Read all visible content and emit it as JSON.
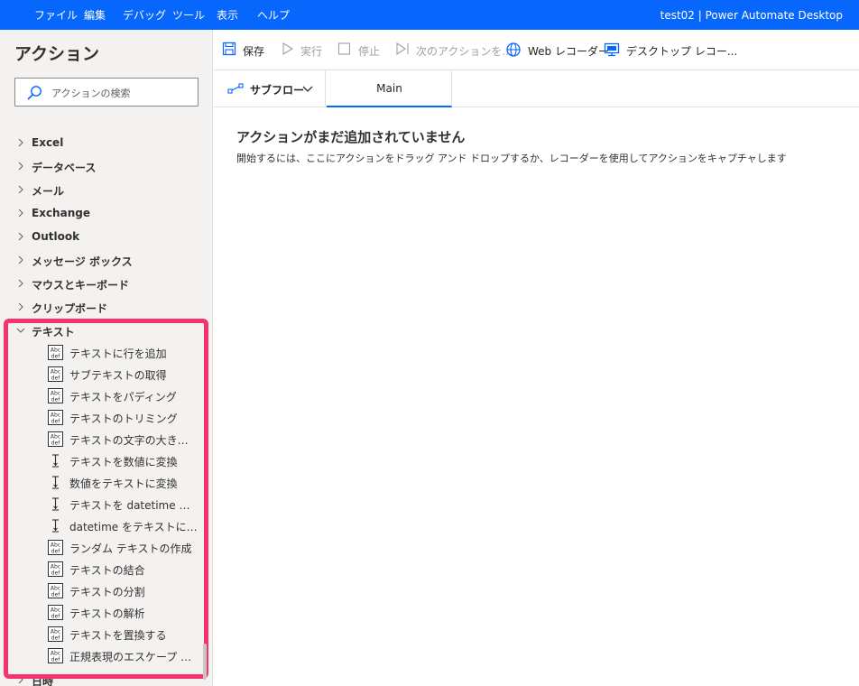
{
  "menubar": {
    "items": [
      "ファイル",
      "編集",
      "デバッグ",
      "ツール",
      "表示",
      "ヘルプ"
    ],
    "window_title": "test02 | Power Automate Desktop"
  },
  "sidebar": {
    "title": "アクション",
    "search_placeholder": "アクションの検索",
    "groups": [
      {
        "label": "Excel",
        "expanded": false
      },
      {
        "label": "データベース",
        "expanded": false
      },
      {
        "label": "メール",
        "expanded": false
      },
      {
        "label": "Exchange",
        "expanded": false
      },
      {
        "label": "Outlook",
        "expanded": false
      },
      {
        "label": "メッセージ ボックス",
        "expanded": false
      },
      {
        "label": "マウスとキーボード",
        "expanded": false
      },
      {
        "label": "クリップボード",
        "expanded": false
      },
      {
        "label": "テキスト",
        "expanded": true
      },
      {
        "label": "日時",
        "expanded": false
      }
    ],
    "text_actions": [
      {
        "label": "テキストに行を追加",
        "icon": "abc-def-icon"
      },
      {
        "label": "サブテキストの取得",
        "icon": "abc-def-icon"
      },
      {
        "label": "テキストをパディング",
        "icon": "abc-def-icon"
      },
      {
        "label": "テキストのトリミング",
        "icon": "abc-def-icon"
      },
      {
        "label": "テキストの文字の大きさを変更",
        "icon": "abc-def-icon"
      },
      {
        "label": "テキストを数値に変換",
        "icon": "convert-icon"
      },
      {
        "label": "数値をテキストに変換",
        "icon": "convert-icon"
      },
      {
        "label": "テキストを datetime に変換",
        "icon": "convert-icon"
      },
      {
        "label": "datetime をテキストに変換",
        "icon": "convert-icon"
      },
      {
        "label": "ランダム テキストの作成",
        "icon": "abc-def-icon"
      },
      {
        "label": "テキストの結合",
        "icon": "abc-def-icon"
      },
      {
        "label": "テキストの分割",
        "icon": "abc-def-icon"
      },
      {
        "label": "テキストの解析",
        "icon": "abc-def-icon"
      },
      {
        "label": "テキストを置換する",
        "icon": "abc-def-icon"
      },
      {
        "label": "正規表現のエスケープ テキスト",
        "icon": "abc-def-icon"
      }
    ]
  },
  "toolbar": {
    "save": "保存",
    "run": "実行",
    "stop": "停止",
    "next": "次のアクションを...",
    "web_recorder": "Web レコーダー",
    "desktop_recorder": "デスクトップ レコー..."
  },
  "tabs": {
    "subflow": "サブフロー",
    "main": "Main"
  },
  "canvas": {
    "empty_title": "アクションがまだ追加されていません",
    "empty_desc": "開始するには、ここにアクションをドラッグ アンド ドロップするか、レコーダーを使用してアクションをキャプチャします"
  },
  "colors": {
    "accent": "#0766fb",
    "highlight": "#f7336f",
    "pane_bg": "#f3f2f1"
  }
}
